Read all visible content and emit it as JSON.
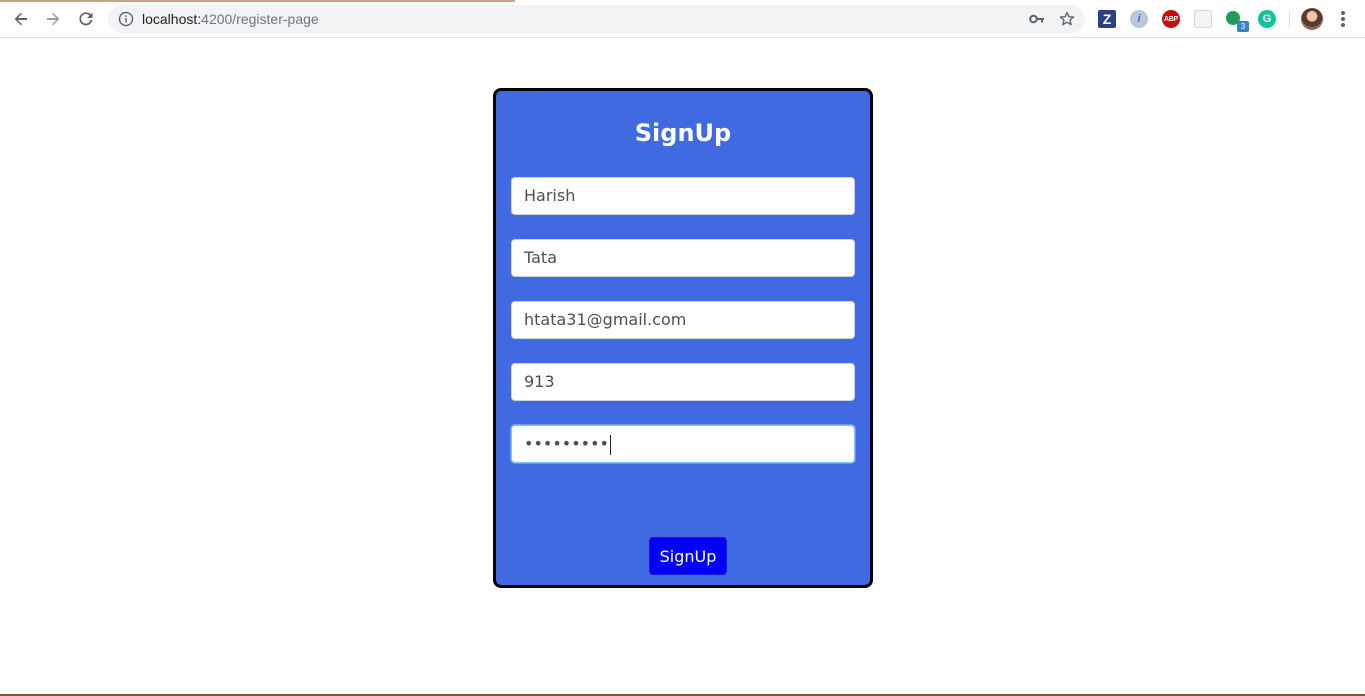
{
  "browser": {
    "url_host": "localhost:",
    "url_path": "4200/register-page",
    "extensions": {
      "z_label": "Z",
      "orb_label": "i",
      "abp_label": "ABP",
      "green_badge": "3",
      "grammarly_label": "G"
    },
    "icons": [
      "back-icon",
      "forward-icon",
      "reload-icon",
      "info-icon",
      "key-icon",
      "star-icon",
      "menu-icon"
    ]
  },
  "form": {
    "title": "SignUp",
    "fields": [
      {
        "name": "first-name",
        "value": "Harish"
      },
      {
        "name": "last-name",
        "value": "Tata"
      },
      {
        "name": "email",
        "value": "htata31@gmail.com"
      },
      {
        "name": "phone",
        "value": "913"
      },
      {
        "name": "password",
        "value": "•••••••••"
      }
    ],
    "submit_label": "SignUp"
  },
  "colors": {
    "card_background": "#4169e1",
    "card_border": "#000000",
    "button_background": "#0000ff",
    "title_color": "#ffffff"
  }
}
